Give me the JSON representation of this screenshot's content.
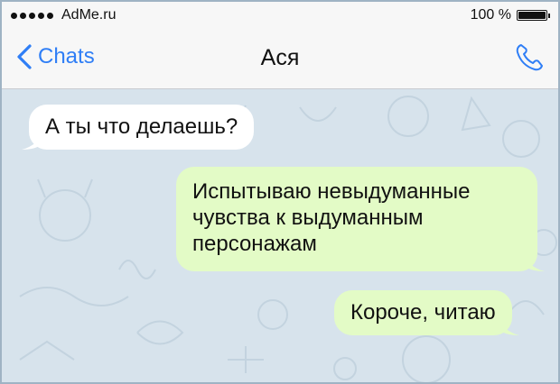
{
  "status_bar": {
    "carrier": "AdMe.ru",
    "battery_percent": "100 %",
    "battery_level": 1.0
  },
  "nav": {
    "back_label": "Chats",
    "title": "Ася",
    "accent_color": "#2f7ef6"
  },
  "messages": [
    {
      "direction": "incoming",
      "text": "А ты что делаешь?"
    },
    {
      "direction": "outgoing",
      "text": "Испытываю невыдуманные чувства к выдуманным персонажам"
    },
    {
      "direction": "outgoing",
      "text": "Короче, читаю"
    }
  ],
  "colors": {
    "incoming_bubble": "#ffffff",
    "outgoing_bubble": "#e3fbc6",
    "chat_background": "#d7e3ec"
  },
  "icons": [
    "signal-dots-icon",
    "battery-icon",
    "chevron-left-icon",
    "phone-icon"
  ]
}
